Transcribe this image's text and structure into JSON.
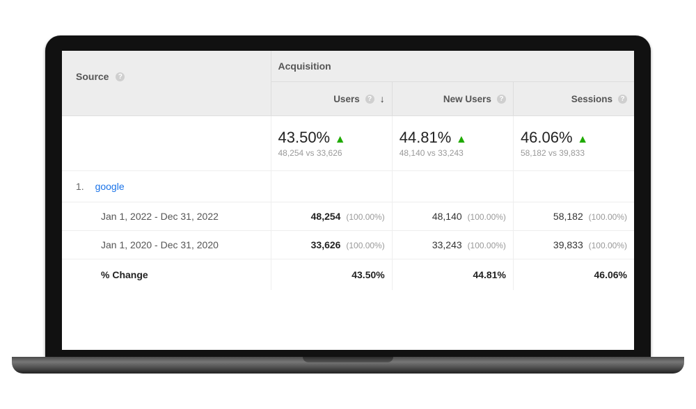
{
  "headers": {
    "source": "Source",
    "acquisition": "Acquisition",
    "metrics": {
      "users": "Users",
      "new_users": "New Users",
      "sessions": "Sessions"
    }
  },
  "summary": {
    "users": {
      "pct": "43.50%",
      "compare": "48,254 vs 33,626"
    },
    "new_users": {
      "pct": "44.81%",
      "compare": "48,140 vs 33,243"
    },
    "sessions": {
      "pct": "46.06%",
      "compare": "58,182 vs 39,833"
    }
  },
  "row": {
    "index": "1.",
    "source_name": "google",
    "period_a": {
      "label": "Jan 1, 2022 - Dec 31, 2022",
      "users": {
        "value": "48,254",
        "share": "(100.00%)"
      },
      "new_users": {
        "value": "48,140",
        "share": "(100.00%)"
      },
      "sessions": {
        "value": "58,182",
        "share": "(100.00%)"
      }
    },
    "period_b": {
      "label": "Jan 1, 2020 - Dec 31, 2020",
      "users": {
        "value": "33,626",
        "share": "(100.00%)"
      },
      "new_users": {
        "value": "33,243",
        "share": "(100.00%)"
      },
      "sessions": {
        "value": "39,833",
        "share": "(100.00%)"
      }
    },
    "change": {
      "label": "% Change",
      "users": "43.50%",
      "new_users": "44.81%",
      "sessions": "46.06%"
    }
  }
}
